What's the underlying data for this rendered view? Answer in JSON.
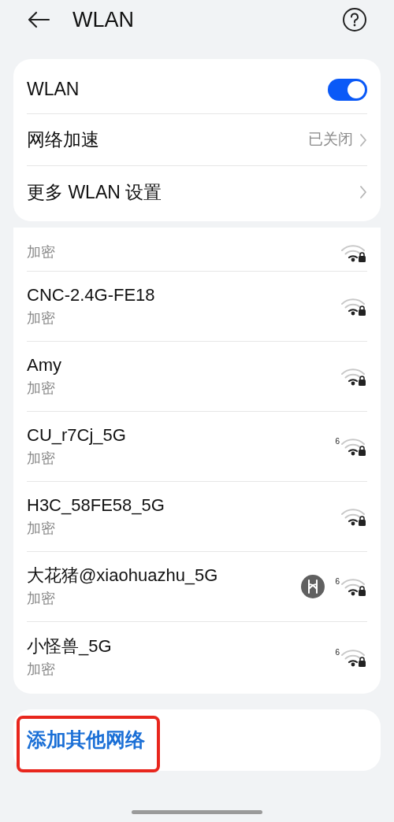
{
  "header": {
    "title": "WLAN"
  },
  "settings": [
    {
      "kind": "toggle",
      "label": "WLAN",
      "on": true
    },
    {
      "kind": "link",
      "label": "网络加速",
      "value": "已关闭"
    },
    {
      "kind": "link",
      "label": "更多 WLAN 设置"
    }
  ],
  "networks": [
    {
      "security": "加密"
    },
    {
      "name": "CNC-2.4G-FE18",
      "security": "加密"
    },
    {
      "name": "Amy",
      "security": "加密"
    },
    {
      "name": "CU_r7Cj_5G",
      "security": "加密",
      "badge": "6"
    },
    {
      "name": "H3C_58FE58_5G",
      "security": "加密"
    },
    {
      "name": "大花猪@xiaohuazhu_5G",
      "security": "加密",
      "badge": "6",
      "shared": true
    },
    {
      "name": "小怪兽_5G",
      "security": "加密",
      "badge": "6"
    }
  ],
  "add_network": {
    "label": "添加其他网络",
    "highlighted": true
  }
}
